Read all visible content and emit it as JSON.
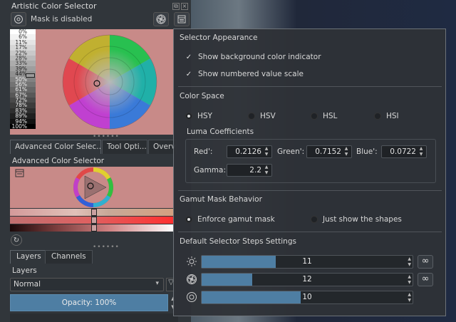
{
  "left_dock": {
    "title": "Artistic Color Selector",
    "mask_label": "Mask is disabled",
    "value_scale": [
      "0%",
      "6%",
      "11%",
      "17%",
      "22%",
      "28%",
      "33%",
      "39%",
      "44%",
      "50%",
      "56%",
      "61%",
      "67%",
      "72%",
      "78%",
      "83%",
      "89%",
      "94%",
      "100%"
    ],
    "tabs": [
      "Advanced Color Selec...",
      "Tool Opti...",
      "Overv"
    ],
    "adv_label": "Advanced Color Selector",
    "splitter": "••••••",
    "layers_tabs": [
      "Layers",
      "Channels"
    ],
    "layers_title": "Layers",
    "blend_mode": "Normal",
    "opacity": "Opacity:  100%"
  },
  "popup": {
    "appearance": {
      "title": "Selector Appearance",
      "show_bg_indicator": "Show background color indicator",
      "show_numbered_scale": "Show numbered value scale"
    },
    "color_space": {
      "title": "Color Space",
      "options": [
        "HSY",
        "HSV",
        "HSL",
        "HSI"
      ],
      "selected": "HSY"
    },
    "luma": {
      "title": "Luma Coefficients",
      "red_label": "Red':",
      "red": "0.2126",
      "green_label": "Green':",
      "green": "0.7152",
      "blue_label": "Blue':",
      "blue": "0.0722",
      "gamma_label": "Gamma:",
      "gamma": "2.2"
    },
    "gamut": {
      "title": "Gamut Mask Behavior",
      "enforce": "Enforce gamut mask",
      "shapes": "Just show the shapes",
      "selected": "enforce"
    },
    "steps": {
      "title": "Default Selector Steps Settings",
      "rows": [
        {
          "icon": "brightness-icon",
          "value": "11",
          "fill": 0.35
        },
        {
          "icon": "aperture-icon",
          "value": "12",
          "fill": 0.24
        },
        {
          "icon": "ring-icon",
          "value": "10",
          "fill": 0.47
        }
      ],
      "infinity": "∞"
    }
  },
  "colors": {
    "accent_blue": "#4e7ea3",
    "selector_bg": "#c88a88"
  }
}
